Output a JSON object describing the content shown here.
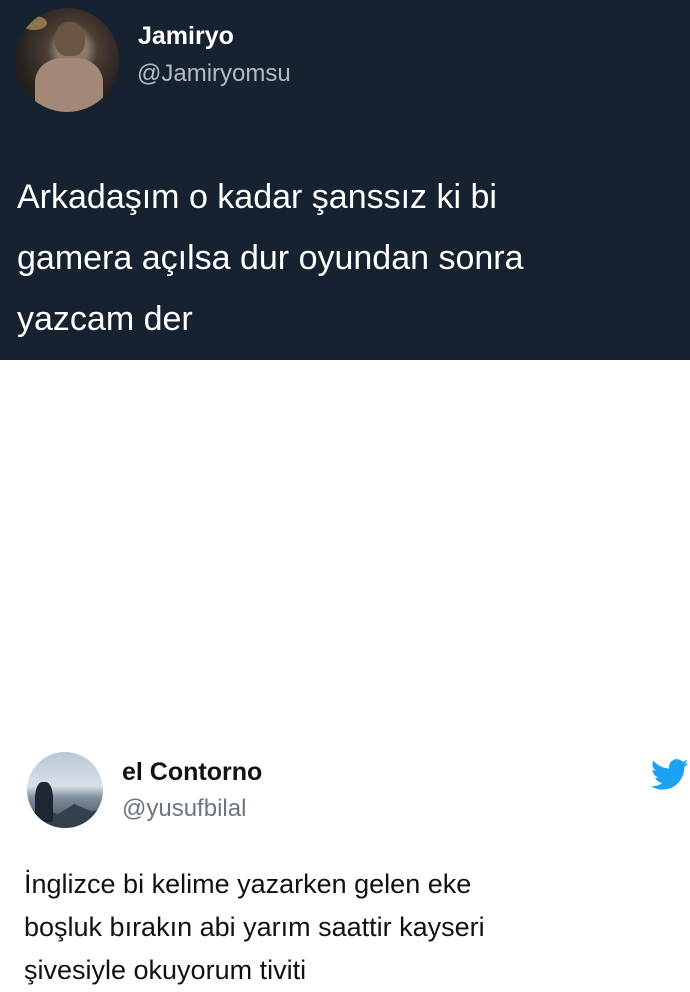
{
  "colors": {
    "dark_background": "#172230",
    "light_background": "#ffffff",
    "twitter_blue": "#1da1f2"
  },
  "quoted_tweet": {
    "display_name": "Jamiryo",
    "handle": "@Jamiryomsu",
    "text": "Arkadaşım o kadar şanssız ki bi\ngamera açılsa dur oyundan sonra\nyazcam der"
  },
  "reply_tweet": {
    "display_name": "el Contorno",
    "handle": "@yusufbilal",
    "text": "İnglizce bi kelime yazarken gelen eke\nboşluk bırakın abi yarım saattir kayseri\nşivesiyle okuyorum tiviti",
    "icon": "twitter-bird-icon"
  }
}
